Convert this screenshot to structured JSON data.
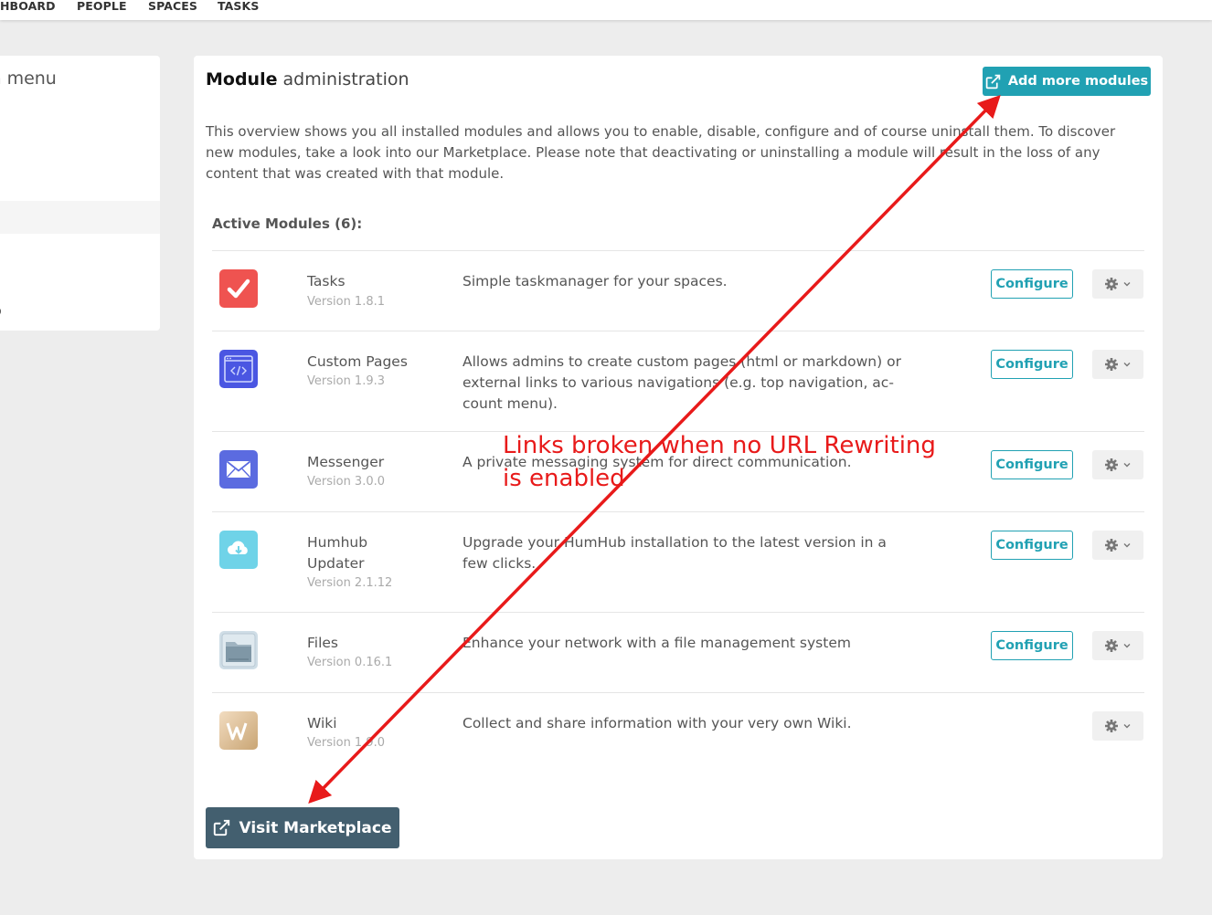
{
  "topnav": [
    "HBOARD",
    "PEOPLE",
    "SPACES",
    "TASKS"
  ],
  "sidebar": {
    "title_bold": "n",
    "title_rest": " menu",
    "item": "ub"
  },
  "panel": {
    "title_bold": "Module",
    "title_rest": " administration",
    "add_modules_label": "Add more modules",
    "intro": "This overview shows you all installed modules and allows you to enable, disable, configure and of course uninstall them. To discover new modules, take a look into our Marketplace. Please note that deactivating or uninstalling a module will result in the loss of any content that was created with that module.",
    "section_title": "Active Modules (6):",
    "configure_label": "Configure",
    "visit_marketplace_label": "Visit Marketplace",
    "modules": [
      {
        "name": "Tasks",
        "version": "Version 1.8.1",
        "description": "Simple taskmanager for your spaces.",
        "icon": "tasks-icon",
        "color": "#ef5350"
      },
      {
        "name": "Custom Pages",
        "version": "Version 1.9.3",
        "description": "Allows admins to create custom pages (html or markdown) or external links to various navigations (e.g. top navigation, ac-count menu).",
        "icon": "custom-pages-icon",
        "color": "#4a56e2"
      },
      {
        "name": "Messenger",
        "version": "Version 3.0.0",
        "description": "A private messaging system for direct communication.",
        "icon": "messenger-icon",
        "color": "#5b6be0"
      },
      {
        "name": "Humhub Updater",
        "version": "Version 2.1.12",
        "description": "Upgrade your HumHub installation to the latest version in a few clicks.",
        "icon": "updater-icon",
        "color": "#6fd3e8"
      },
      {
        "name": "Files",
        "version": "Version 0.16.1",
        "description": "Enhance your network with a file management system",
        "icon": "files-icon",
        "color": "#cfdde6"
      },
      {
        "name": "Wiki",
        "version": "Version 1.9.0",
        "description": "Collect and share information with your very own Wiki.",
        "icon": "wiki-icon",
        "color": "#d8b88a"
      }
    ]
  },
  "annotation": "Links broken when no URL Rewriting is enabled",
  "colors": {
    "accent": "#21a1b3",
    "dark_button": "#435f6f",
    "annotation": "#e81a1a"
  }
}
